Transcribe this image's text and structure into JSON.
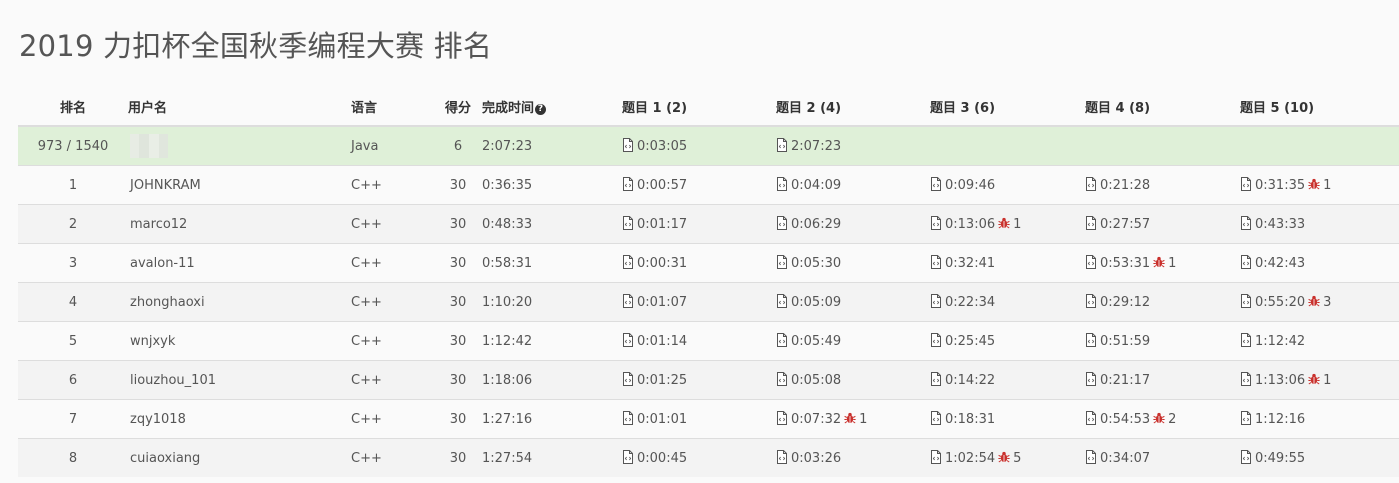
{
  "title": "2019 力扣杯全国秋季编程大赛 排名",
  "headers": {
    "rank": "排名",
    "user": "用户名",
    "lang": "语言",
    "score": "得分",
    "time": "完成时间",
    "q1": "题目 1 (2)",
    "q2": "题目 2 (4)",
    "q3": "题目 3 (6)",
    "q4": "题目 4 (8)",
    "q5": "题目 5 (10)"
  },
  "icons": {
    "help": "question-circle-icon",
    "submission": "code-file-icon",
    "wrong": "bug-icon"
  },
  "colors": {
    "highlight_row": "#dff0d8",
    "bug": "#c9302c"
  },
  "my_row": {
    "rank": "973 / 1540",
    "user": "",
    "lang": "Java",
    "score": "6",
    "time": "2:07:23",
    "q": [
      {
        "t": "0:03:05",
        "bugs": ""
      },
      {
        "t": "2:07:23",
        "bugs": ""
      },
      {
        "t": "",
        "bugs": ""
      },
      {
        "t": "",
        "bugs": ""
      },
      {
        "t": "",
        "bugs": ""
      }
    ]
  },
  "rows": [
    {
      "rank": "1",
      "user": "JOHNKRAM",
      "lang": "C++",
      "score": "30",
      "time": "0:36:35",
      "q": [
        {
          "t": "0:00:57",
          "bugs": ""
        },
        {
          "t": "0:04:09",
          "bugs": ""
        },
        {
          "t": "0:09:46",
          "bugs": ""
        },
        {
          "t": "0:21:28",
          "bugs": ""
        },
        {
          "t": "0:31:35",
          "bugs": "1"
        }
      ]
    },
    {
      "rank": "2",
      "user": "marco12",
      "lang": "C++",
      "score": "30",
      "time": "0:48:33",
      "q": [
        {
          "t": "0:01:17",
          "bugs": ""
        },
        {
          "t": "0:06:29",
          "bugs": ""
        },
        {
          "t": "0:13:06",
          "bugs": "1"
        },
        {
          "t": "0:27:57",
          "bugs": ""
        },
        {
          "t": "0:43:33",
          "bugs": ""
        }
      ]
    },
    {
      "rank": "3",
      "user": "avalon-11",
      "lang": "C++",
      "score": "30",
      "time": "0:58:31",
      "q": [
        {
          "t": "0:00:31",
          "bugs": ""
        },
        {
          "t": "0:05:30",
          "bugs": ""
        },
        {
          "t": "0:32:41",
          "bugs": ""
        },
        {
          "t": "0:53:31",
          "bugs": "1"
        },
        {
          "t": "0:42:43",
          "bugs": ""
        }
      ]
    },
    {
      "rank": "4",
      "user": "zhonghaoxi",
      "lang": "C++",
      "score": "30",
      "time": "1:10:20",
      "q": [
        {
          "t": "0:01:07",
          "bugs": ""
        },
        {
          "t": "0:05:09",
          "bugs": ""
        },
        {
          "t": "0:22:34",
          "bugs": ""
        },
        {
          "t": "0:29:12",
          "bugs": ""
        },
        {
          "t": "0:55:20",
          "bugs": "3"
        }
      ]
    },
    {
      "rank": "5",
      "user": "wnjxyk",
      "lang": "C++",
      "score": "30",
      "time": "1:12:42",
      "q": [
        {
          "t": "0:01:14",
          "bugs": ""
        },
        {
          "t": "0:05:49",
          "bugs": ""
        },
        {
          "t": "0:25:45",
          "bugs": ""
        },
        {
          "t": "0:51:59",
          "bugs": ""
        },
        {
          "t": "1:12:42",
          "bugs": ""
        }
      ]
    },
    {
      "rank": "6",
      "user": "liouzhou_101",
      "lang": "C++",
      "score": "30",
      "time": "1:18:06",
      "q": [
        {
          "t": "0:01:25",
          "bugs": ""
        },
        {
          "t": "0:05:08",
          "bugs": ""
        },
        {
          "t": "0:14:22",
          "bugs": ""
        },
        {
          "t": "0:21:17",
          "bugs": ""
        },
        {
          "t": "1:13:06",
          "bugs": "1"
        }
      ]
    },
    {
      "rank": "7",
      "user": "zqy1018",
      "lang": "C++",
      "score": "30",
      "time": "1:27:16",
      "q": [
        {
          "t": "0:01:01",
          "bugs": ""
        },
        {
          "t": "0:07:32",
          "bugs": "1"
        },
        {
          "t": "0:18:31",
          "bugs": ""
        },
        {
          "t": "0:54:53",
          "bugs": "2"
        },
        {
          "t": "1:12:16",
          "bugs": ""
        }
      ]
    },
    {
      "rank": "8",
      "user": "cuiaoxiang",
      "lang": "C++",
      "score": "30",
      "time": "1:27:54",
      "q": [
        {
          "t": "0:00:45",
          "bugs": ""
        },
        {
          "t": "0:03:26",
          "bugs": ""
        },
        {
          "t": "1:02:54",
          "bugs": "5"
        },
        {
          "t": "0:34:07",
          "bugs": ""
        },
        {
          "t": "0:49:55",
          "bugs": ""
        }
      ]
    }
  ]
}
